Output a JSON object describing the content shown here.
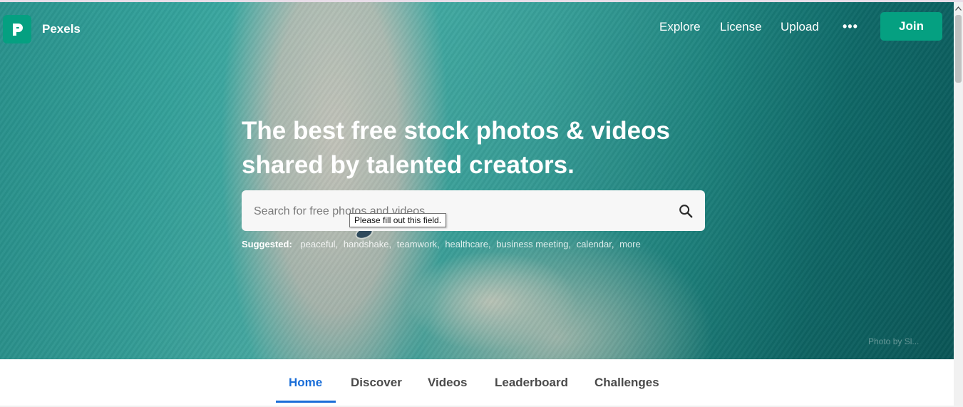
{
  "header": {
    "brand": "Pexels",
    "nav": [
      "Explore",
      "License",
      "Upload"
    ],
    "more": "•••",
    "join_label": "Join"
  },
  "hero": {
    "headline_line1": "The best free stock photos & videos",
    "headline_line2": "shared by talented creators.",
    "search_placeholder": "Search for free photos and videos",
    "tooltip": "Please fill out this field.",
    "suggested_label": "Suggested:",
    "suggestions": [
      "peaceful",
      "handshake",
      "teamwork",
      "healthcare",
      "business meeting",
      "calendar",
      "more"
    ],
    "credit": "Photo by Sl..."
  },
  "tabs": {
    "items": [
      "Home",
      "Discover",
      "Videos",
      "Leaderboard",
      "Challenges"
    ],
    "active": "Home"
  },
  "colors": {
    "brand_green": "#05a081",
    "active_tab": "#1a6ed8"
  }
}
